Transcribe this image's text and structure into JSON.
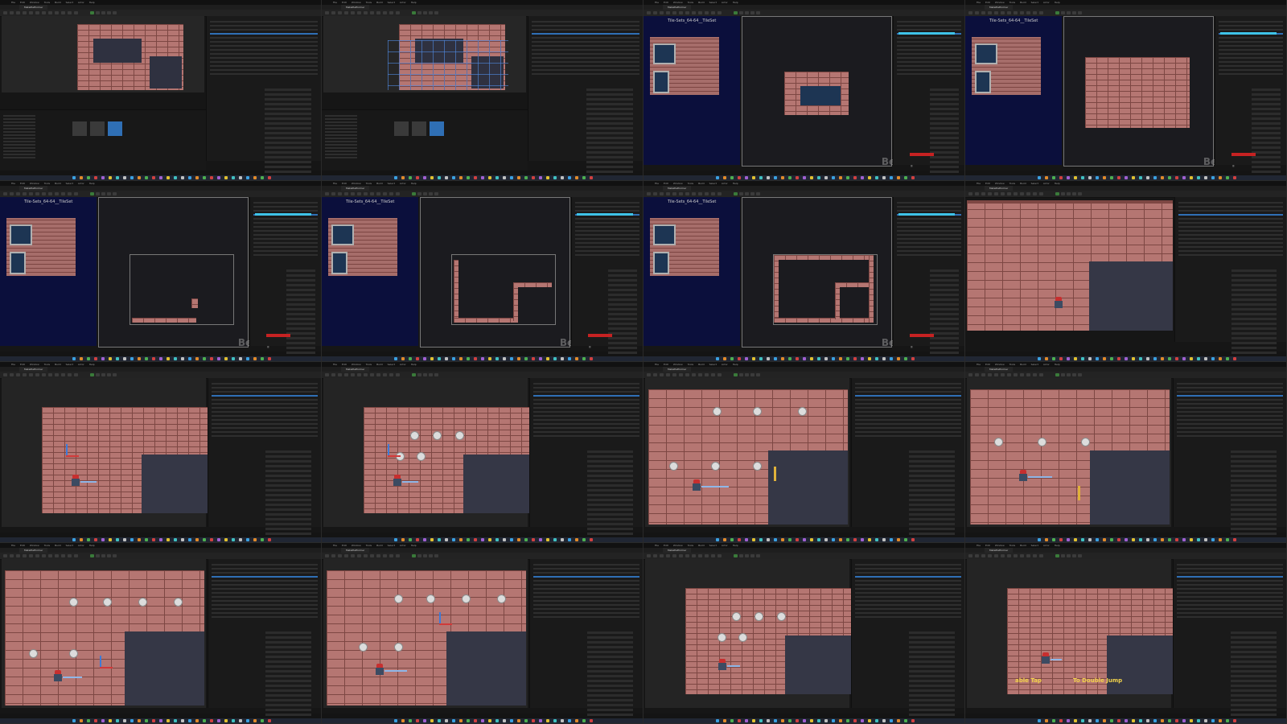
{
  "menu": [
    "File",
    "Edit",
    "Window",
    "Tools",
    "Build",
    "Select",
    "Actor",
    "Help"
  ],
  "level_tab": "MetaPlatformer",
  "tileset_title": "Tile-Sets_64-64__TileSet",
  "beta_label": "Beta preview",
  "subtitles": {
    "left": "able Tap",
    "right": "To Double Jump"
  },
  "colors": {
    "brick": "#b57672",
    "mortar": "#7d4743",
    "tileset_bg": "#0b0f3c",
    "accent": "#2f6fb5",
    "subtitle": "#f2d24b"
  },
  "tiles": [
    {
      "kind": "editor-topdown",
      "label": "tile-1"
    },
    {
      "kind": "editor-topdown-grid",
      "label": "tile-2"
    },
    {
      "kind": "tileset-preview",
      "label": "tile-3"
    },
    {
      "kind": "tileset-blank",
      "label": "tile-4"
    },
    {
      "kind": "tileset-small",
      "label": "tile-5"
    },
    {
      "kind": "tileset-L",
      "label": "tile-6"
    },
    {
      "kind": "tileset-U",
      "label": "tile-7"
    },
    {
      "kind": "game-wide",
      "label": "tile-8"
    },
    {
      "kind": "editor-level",
      "label": "tile-9"
    },
    {
      "kind": "editor-level-orbs",
      "label": "tile-10"
    },
    {
      "kind": "editor-zoom-orbs",
      "label": "tile-11"
    },
    {
      "kind": "editor-zoom-orbs2",
      "label": "tile-12"
    },
    {
      "kind": "editor-orbs-full",
      "label": "tile-13"
    },
    {
      "kind": "editor-orbs-full2",
      "label": "tile-14"
    },
    {
      "kind": "editor-small-orbs",
      "label": "tile-15"
    },
    {
      "kind": "editor-subtitle",
      "label": "tile-16"
    }
  ]
}
